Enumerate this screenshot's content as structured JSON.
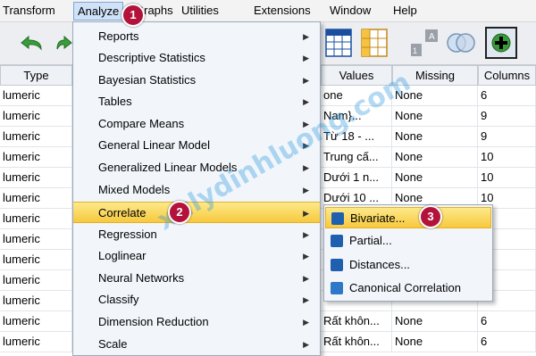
{
  "menubar": {
    "items": [
      "Transform",
      "Analyze",
      "Graphs",
      "Utilities",
      "Extensions",
      "Window",
      "Help"
    ]
  },
  "toolbar": {
    "icons": [
      "undo-icon",
      "redo-icon",
      "grid-icon",
      "insert-variable-icon",
      "venn-icon",
      "add-icon"
    ]
  },
  "grid": {
    "columns": [
      "Type",
      "Values",
      "Missing",
      "Columns"
    ],
    "type_cells": [
      "lumeric",
      "lumeric",
      "lumeric",
      "lumeric",
      "lumeric",
      "lumeric",
      "lumeric",
      "lumeric",
      "lumeric",
      "lumeric",
      "lumeric",
      "lumeric",
      "lumeric"
    ],
    "values_cells": [
      "one",
      "Nam}...",
      "Từ 18 - ...",
      "Trung cấ...",
      "Dưới 1 n...",
      "Dưới 10 ...",
      "",
      "",
      "",
      "",
      "",
      "Rất khôn...",
      "Rất khôn..."
    ],
    "missing_cells": [
      "None",
      "None",
      "None",
      "None",
      "None",
      "None",
      "",
      "",
      "",
      "",
      "",
      "None",
      "None"
    ],
    "columns_cells": [
      "6",
      "9",
      "9",
      "10",
      "10",
      "10",
      "",
      "",
      "",
      "",
      "",
      "6",
      "6"
    ]
  },
  "analyze_menu": {
    "items": [
      "Reports",
      "Descriptive Statistics",
      "Bayesian Statistics",
      "Tables",
      "Compare Means",
      "General Linear Model",
      "Generalized Linear Models",
      "Mixed Models",
      "Correlate",
      "Regression",
      "Loglinear",
      "Neural Networks",
      "Classify",
      "Dimension Reduction",
      "Scale"
    ],
    "highlighted": "Correlate"
  },
  "correlate_submenu": {
    "items": [
      "Bivariate...",
      "Partial...",
      "Distances...",
      "Canonical Correlation"
    ],
    "highlighted": "Bivariate..."
  },
  "badges": [
    "1",
    "2",
    "3"
  ],
  "watermark": "xulydinhluong.com",
  "colors": {
    "highlight": "#f7c93e",
    "badge": "#b3123b",
    "menu_bg": "#f2f6fb"
  }
}
